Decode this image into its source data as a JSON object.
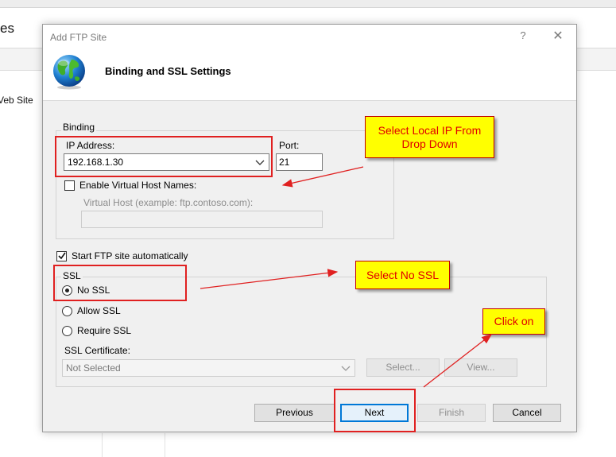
{
  "background": {
    "title_fragment": "es",
    "item_fragment": "Veb Site"
  },
  "dialog": {
    "title": "Add FTP Site",
    "help_glyph": "?",
    "close_glyph": "✕",
    "header_title": "Binding and SSL Settings",
    "icons": {
      "header": "globe-icon",
      "help": "help-icon",
      "close": "close-icon"
    },
    "binding": {
      "group_label": "Binding",
      "ip_label": "IP Address:",
      "ip_value": "192.168.1.30",
      "port_label": "Port:",
      "port_value": "21",
      "virtual_host_checkbox_label": "Enable Virtual Host Names:",
      "virtual_host_checked": false,
      "virtual_host_label": "Virtual Host (example: ftp.contoso.com):",
      "virtual_host_value": ""
    },
    "start_auto": {
      "label": "Start FTP site automatically",
      "checked": true
    },
    "ssl": {
      "group_label": "SSL",
      "options": [
        {
          "label": "No SSL",
          "selected": true
        },
        {
          "label": "Allow SSL",
          "selected": false
        },
        {
          "label": "Require SSL",
          "selected": false
        }
      ],
      "cert_label": "SSL Certificate:",
      "cert_value": "Not Selected",
      "select_button": "Select...",
      "view_button": "View..."
    },
    "buttons": {
      "previous": "Previous",
      "next": "Next",
      "finish": "Finish",
      "cancel": "Cancel"
    }
  },
  "annotations": {
    "callout_ip": "Select Local IP From Drop Down",
    "callout_ssl": "Select No SSL",
    "callout_next": "Click on",
    "colors": {
      "callout_bg": "#ffff00",
      "callout_text": "#e00000",
      "highlight": "#e02020"
    }
  }
}
